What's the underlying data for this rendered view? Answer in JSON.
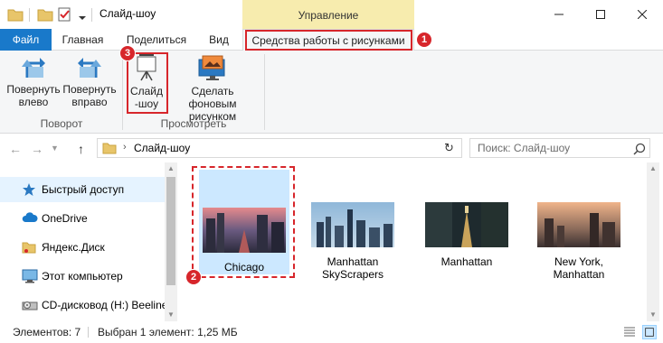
{
  "window": {
    "title": "Слайд-шоу",
    "context_tab_header": "Управление"
  },
  "ribbon_tabs": {
    "file": "Файл",
    "home": "Главная",
    "share": "Поделиться",
    "view": "Вид",
    "picture_tools": "Средства работы с рисунками"
  },
  "ribbon": {
    "rotate_left": [
      "Повернуть",
      "влево"
    ],
    "rotate_right": [
      "Повернуть",
      "вправо"
    ],
    "slideshow": [
      "Слайд",
      "-шоу"
    ],
    "set_background": [
      "Сделать фоновым",
      "рисунком"
    ],
    "group_rotate": "Поворот",
    "group_view": "Просмотреть"
  },
  "address": {
    "path": "Слайд-шоу",
    "search_placeholder": "Поиск: Слайд-шоу"
  },
  "nav": {
    "items": [
      {
        "label": "Быстрый доступ",
        "icon": "star-icon"
      },
      {
        "label": "OneDrive",
        "icon": "cloud-icon"
      },
      {
        "label": "Яндекс.Диск",
        "icon": "folder-icon"
      },
      {
        "label": "Этот компьютер",
        "icon": "computer-icon"
      },
      {
        "label": "CD-дисковод (H:) Beeline",
        "icon": "cd-drive-icon"
      }
    ]
  },
  "files": [
    {
      "name": "Chicago",
      "selected": true
    },
    {
      "name": "Manhattan SkyScrapers",
      "line1": "Manhattan",
      "line2": "SkyScrapers"
    },
    {
      "name": "Manhattan"
    },
    {
      "name": "New York, Manhattan",
      "line1": "New York,",
      "line2": "Manhattan"
    }
  ],
  "status": {
    "count": "Элементов: 7",
    "selection": "Выбран 1 элемент: 1,25 МБ"
  },
  "callouts": {
    "one": "1",
    "two": "2",
    "three": "3"
  },
  "colors": {
    "accent": "#1979ca",
    "callout": "#d7262b",
    "context_tab": "#f7ecae",
    "selection": "#cce8ff"
  }
}
